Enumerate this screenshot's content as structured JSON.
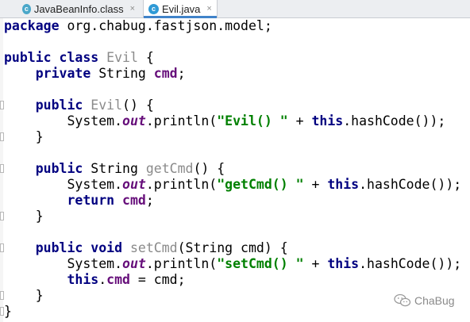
{
  "tabs": [
    {
      "label": "JavaBeanInfo.class",
      "icon": "class-file-icon",
      "icon_glyph": "c",
      "icon_color": "#4aa7c9",
      "active": false
    },
    {
      "label": "Evil.java",
      "icon": "java-class-icon",
      "icon_glyph": "c",
      "icon_color": "#2f9ad6",
      "active": true
    }
  ],
  "tab_close_glyph": "×",
  "code_lines": [
    [
      {
        "t": "kw",
        "v": "package"
      },
      {
        "t": "plain",
        "v": " org.chabug.fastjson.model;"
      }
    ],
    [],
    [
      {
        "t": "kw",
        "v": "public class"
      },
      {
        "t": "plain",
        "v": " "
      },
      {
        "t": "decl",
        "v": "Evil"
      },
      {
        "t": "plain",
        "v": " {"
      }
    ],
    [
      {
        "t": "plain",
        "v": "    "
      },
      {
        "t": "kw",
        "v": "private"
      },
      {
        "t": "plain",
        "v": " String "
      },
      {
        "t": "fld",
        "v": "cmd"
      },
      {
        "t": "plain",
        "v": ";"
      }
    ],
    [],
    [
      {
        "t": "plain",
        "v": "    "
      },
      {
        "t": "kw",
        "v": "public"
      },
      {
        "t": "plain",
        "v": " "
      },
      {
        "t": "decl",
        "v": "Evil"
      },
      {
        "t": "plain",
        "v": "() {"
      }
    ],
    [
      {
        "t": "plain",
        "v": "        System."
      },
      {
        "t": "sfld",
        "v": "out"
      },
      {
        "t": "plain",
        "v": ".println("
      },
      {
        "t": "str",
        "v": "\"Evil() \""
      },
      {
        "t": "plain",
        "v": " + "
      },
      {
        "t": "kw",
        "v": "this"
      },
      {
        "t": "plain",
        "v": ".hashCode());"
      }
    ],
    [
      {
        "t": "plain",
        "v": "    }"
      }
    ],
    [],
    [
      {
        "t": "plain",
        "v": "    "
      },
      {
        "t": "kw",
        "v": "public"
      },
      {
        "t": "plain",
        "v": " String "
      },
      {
        "t": "decl",
        "v": "getCmd"
      },
      {
        "t": "plain",
        "v": "() {"
      }
    ],
    [
      {
        "t": "plain",
        "v": "        System."
      },
      {
        "t": "sfld",
        "v": "out"
      },
      {
        "t": "plain",
        "v": ".println("
      },
      {
        "t": "str",
        "v": "\"getCmd() \""
      },
      {
        "t": "plain",
        "v": " + "
      },
      {
        "t": "kw",
        "v": "this"
      },
      {
        "t": "plain",
        "v": ".hashCode());"
      }
    ],
    [
      {
        "t": "plain",
        "v": "        "
      },
      {
        "t": "kw",
        "v": "return"
      },
      {
        "t": "plain",
        "v": " "
      },
      {
        "t": "fld",
        "v": "cmd"
      },
      {
        "t": "plain",
        "v": ";"
      }
    ],
    [
      {
        "t": "plain",
        "v": "    }"
      }
    ],
    [],
    [
      {
        "t": "plain",
        "v": "    "
      },
      {
        "t": "kw",
        "v": "public void"
      },
      {
        "t": "plain",
        "v": " "
      },
      {
        "t": "decl",
        "v": "setCmd"
      },
      {
        "t": "plain",
        "v": "(String cmd) {"
      }
    ],
    [
      {
        "t": "plain",
        "v": "        System."
      },
      {
        "t": "sfld",
        "v": "out"
      },
      {
        "t": "plain",
        "v": ".println("
      },
      {
        "t": "str",
        "v": "\"setCmd() \""
      },
      {
        "t": "plain",
        "v": " + "
      },
      {
        "t": "kw",
        "v": "this"
      },
      {
        "t": "plain",
        "v": ".hashCode());"
      }
    ],
    [
      {
        "t": "plain",
        "v": "        "
      },
      {
        "t": "kw",
        "v": "this"
      },
      {
        "t": "plain",
        "v": "."
      },
      {
        "t": "fld",
        "v": "cmd"
      },
      {
        "t": "plain",
        "v": " = cmd;"
      }
    ],
    [
      {
        "t": "plain",
        "v": "    }"
      }
    ],
    [
      {
        "t": "plain",
        "v": "}"
      }
    ]
  ],
  "watermark": {
    "icon": "wechat-icon",
    "text": "ChaBug"
  },
  "colors": {
    "keyword": "#000080",
    "declaration": "#8a8a8a",
    "field": "#660e7a",
    "string": "#008000",
    "tab_accent": "#4083c9"
  }
}
